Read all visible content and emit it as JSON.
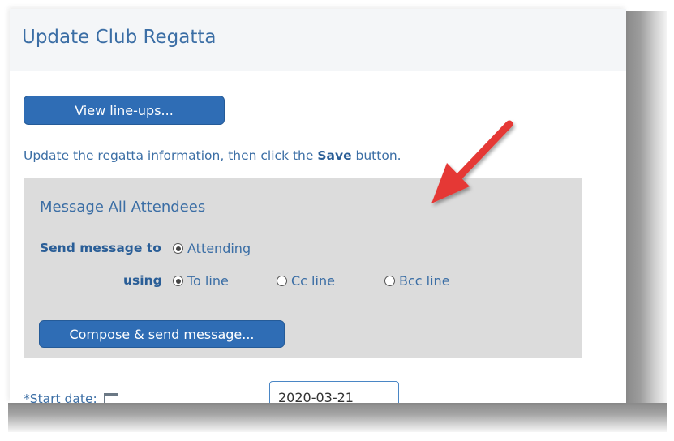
{
  "page": {
    "title": "Update Club Regatta",
    "view_lineups_label": "View line-ups...",
    "instruction_prefix": "Update the regatta information, then click the ",
    "instruction_bold": "Save",
    "instruction_suffix": " button."
  },
  "message_panel": {
    "title": "Message All Attendees",
    "send_to_label": "Send message to",
    "send_to_option": "Attending",
    "using_label": "using",
    "using_options": [
      {
        "label": "To line",
        "checked": true
      },
      {
        "label": "Cc line",
        "checked": false
      },
      {
        "label": "Bcc line",
        "checked": false
      }
    ],
    "compose_label": "Compose & send message..."
  },
  "form": {
    "start_date_label": "*Start date:",
    "start_date_value": "2020-03-21"
  },
  "colors": {
    "accent": "#2f6db5",
    "text_blue": "#3b6ea5",
    "annotation_arrow": "#e53935"
  },
  "icons": {
    "calendar": "calendar-icon",
    "annotation": "red-arrow-annotation"
  }
}
